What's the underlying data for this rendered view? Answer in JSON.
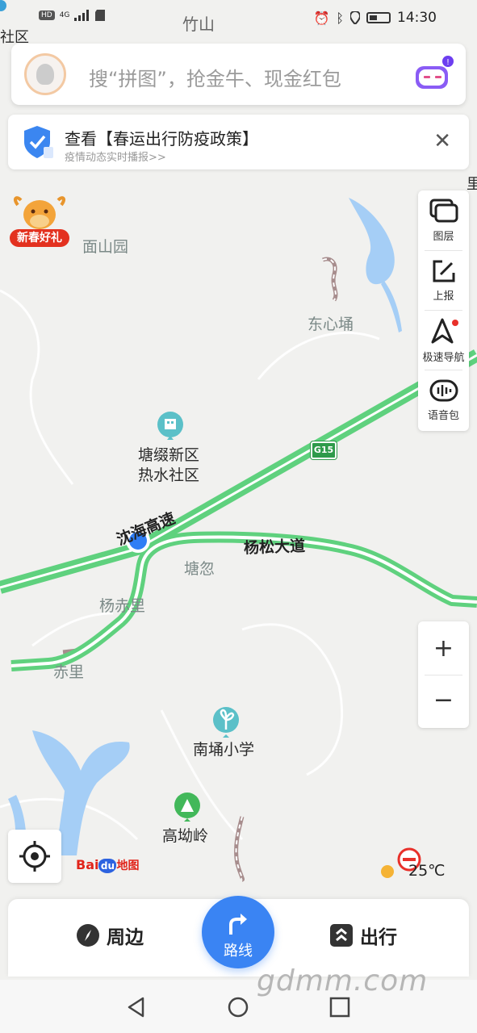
{
  "status_bar": {
    "network": "HD",
    "signal": "4G",
    "carrier_location": "竹山",
    "time": "14:30"
  },
  "search": {
    "placeholder": "搜“拼图”，抢金牛、现金红包"
  },
  "notice": {
    "title": "查看【春运出行防疫政策】",
    "subtitle": "疫情动态实时播报>>",
    "close": "✕"
  },
  "promo": {
    "label": "新春好礼"
  },
  "tools": {
    "layers": "图层",
    "report": "上报",
    "fast_nav": "极速导航",
    "voice_pack": "语音包"
  },
  "zoom": {
    "zoom_in": "+",
    "zoom_out": "−"
  },
  "map": {
    "labels": {
      "top_left_area": "社区",
      "top_right_fragment": "里",
      "mianshanyuan": "面山园",
      "dongxinyong": "东心埇",
      "tangzhui_1": "塘缀新区",
      "tangzhui_2": "热水社区",
      "tanghu": "塘忽",
      "yangchili": "杨赤里",
      "chili": "赤里",
      "nanyong_school": "南埇小学",
      "gaoaoling": "高坳岭"
    },
    "roads": {
      "expressway": "沈海高速",
      "expressway_code": "G15",
      "yangsong": "杨松大道"
    },
    "colors": {
      "road": "#5fd17e",
      "water": "#a5cef6",
      "land": "#f1f1ef",
      "location": "#2f7ef5"
    }
  },
  "logo": {
    "bai": "Bai",
    "du": "du",
    "map": "地图"
  },
  "weather": {
    "temperature": "25℃"
  },
  "bottom": {
    "nearby": "周边",
    "route": "路线",
    "travel": "出行"
  },
  "watermark": "gdmm.com"
}
